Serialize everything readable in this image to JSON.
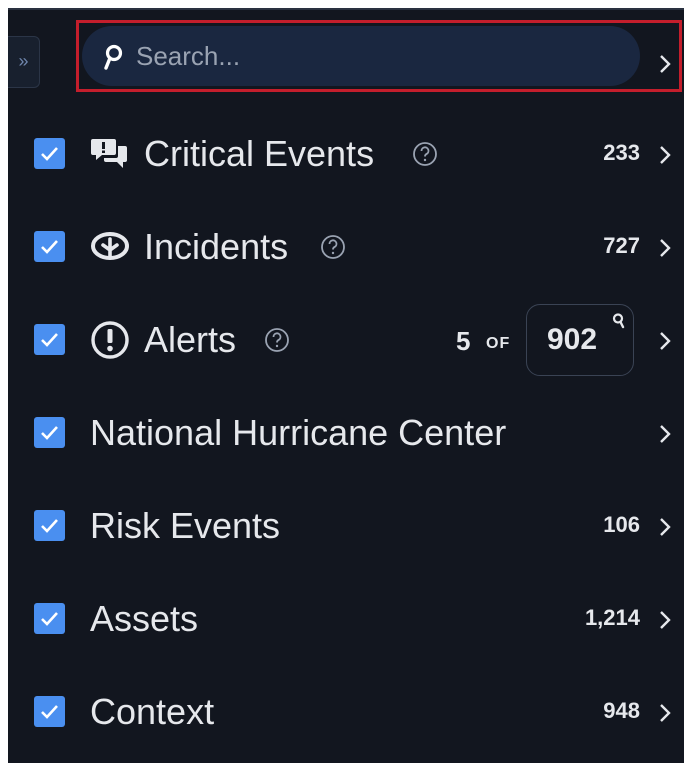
{
  "sidebar": {
    "collapse_glyph": "»",
    "search": {
      "placeholder": "Search...",
      "value": ""
    },
    "layers": [
      {
        "label": "Critical Events",
        "icon": "chat-alert-icon",
        "has_help": true,
        "count": "233"
      },
      {
        "label": "Incidents",
        "icon": "incident-icon",
        "has_help": true,
        "count": "727"
      },
      {
        "label": "Alerts",
        "icon": "exclamation-circle-icon",
        "has_help": true,
        "shown": "5",
        "of_word": "OF",
        "total": "902"
      },
      {
        "label": "National Hurricane Center",
        "has_help": false,
        "count": ""
      },
      {
        "label": "Risk Events",
        "has_help": false,
        "count": "106"
      },
      {
        "label": "Assets",
        "has_help": false,
        "count": "1,214"
      },
      {
        "label": "Context",
        "has_help": false,
        "count": "948"
      }
    ]
  },
  "colors": {
    "panel_bg": "#12161f",
    "checkbox": "#4a8ff0",
    "search_pill": "#1a2740",
    "highlight_outline": "#c41e2c"
  }
}
